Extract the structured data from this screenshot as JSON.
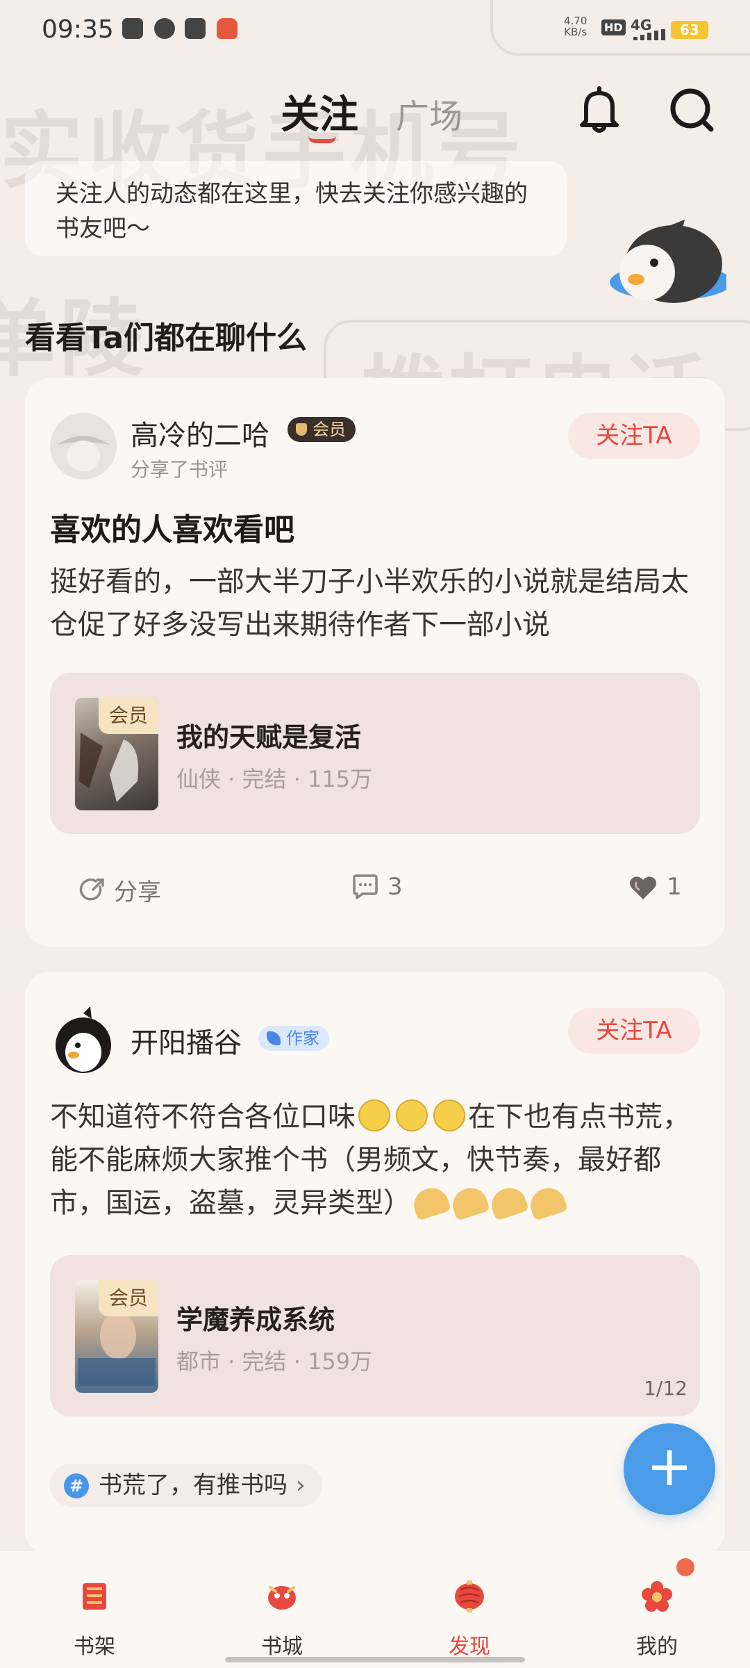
{
  "status_bar": {
    "time": "09:35",
    "net_speed_value": "4.70",
    "net_speed_unit": "KB/s",
    "hd": "HD",
    "signal": "4G",
    "battery": "63"
  },
  "header": {
    "tabs": [
      {
        "label": "关注",
        "active": true
      },
      {
        "label": "广场",
        "active": false
      }
    ],
    "icons": [
      "bell-icon",
      "search-icon"
    ]
  },
  "tip": {
    "text": "关注人的动态都在这里，快去关注你感兴趣的书友吧～"
  },
  "section_title": "看看Ta们都在聊什么",
  "posts": [
    {
      "user": "高冷的二哈",
      "badge": "会员",
      "subtitle": "分享了书评",
      "follow_label": "关注TA",
      "title": "喜欢的人喜欢看吧",
      "body": "挺好看的，一部大半刀子小半欢乐的小说就是结局太仓促了好多没写出来期待作者下一部小说",
      "book": {
        "cover_badge": "会员",
        "title": "我的天赋是复活",
        "meta": "仙侠 · 完结 · 115万"
      },
      "actions": {
        "share": "分享",
        "comments": "3",
        "likes": "1"
      }
    },
    {
      "user": "开阳播谷",
      "badge": "作家",
      "follow_label": "关注TA",
      "body_part1": "不知道符不符合各位口味",
      "body_part2": "在下也有点书荒，能不能麻烦大家推个书（男频文，快节奏，最好都市，国运，盗墓，灵异类型）",
      "book": {
        "cover_badge": "会员",
        "title": "学魔养成系统",
        "meta": "都市 · 完结 · 159万",
        "pager": "1/12"
      },
      "topic": "书荒了，有推书吗"
    }
  ],
  "bottom_nav": [
    {
      "label": "书架",
      "icon": "bookshelf-icon",
      "active": false
    },
    {
      "label": "书城",
      "icon": "bookstore-icon",
      "active": false
    },
    {
      "label": "发现",
      "icon": "discover-icon",
      "active": true
    },
    {
      "label": "我的",
      "icon": "profile-icon",
      "active": false
    }
  ],
  "colors": {
    "accent": "#e8483e",
    "fab": "#4a9be8",
    "background": "#f4ede8",
    "card": "#fbf7f3"
  }
}
